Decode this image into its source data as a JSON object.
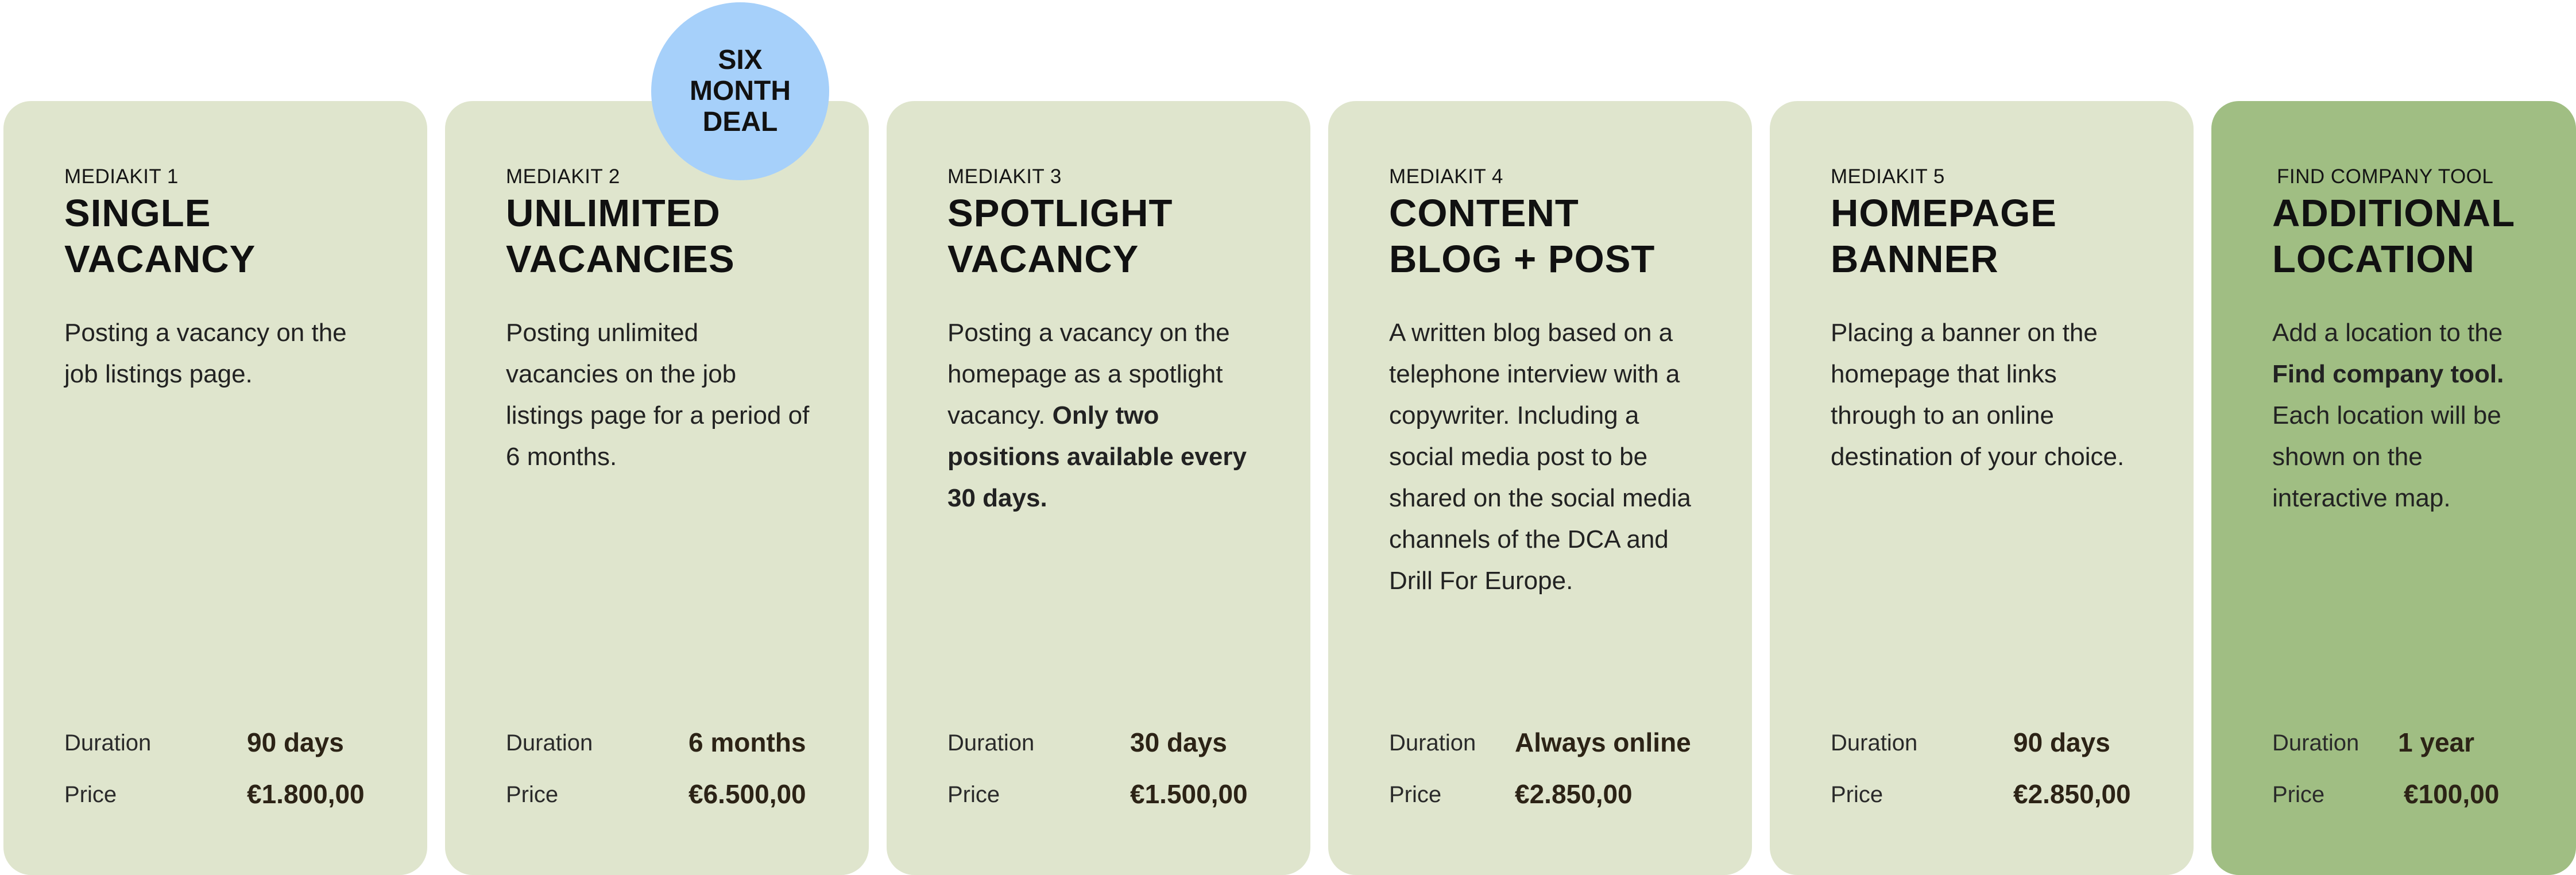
{
  "labels": {
    "duration": "Duration",
    "price": "Price"
  },
  "badge": {
    "line1": "SIX",
    "line2": "MONTH",
    "line3": "DEAL"
  },
  "colors": {
    "card": "#dfe5cd",
    "featured_card": "#a0be83",
    "badge": "#a6d0fa"
  },
  "cards": [
    {
      "eyebrow": "MEDIAKIT 1",
      "title1": "SINGLE",
      "title2": "VACANCY",
      "desc": [
        {
          "t": "Posting a vacancy on the job listings page."
        }
      ],
      "duration": "90 days",
      "price": "€1.800,00"
    },
    {
      "eyebrow": "MEDIAKIT 2",
      "title1": "UNLIMITED",
      "title2": "VACANCIES",
      "desc": [
        {
          "t": "Posting unlimited vacancies on the job listings page for a period of 6 months."
        }
      ],
      "duration": "6 months",
      "price": "€6.500,00"
    },
    {
      "eyebrow": "MEDIAKIT 3",
      "title1": "SPOTLIGHT",
      "title2": "VACANCY",
      "desc": [
        {
          "t": "Posting a vacancy on the homepage as a spotlight vacancy. "
        },
        {
          "t": "Only two positions available every 30 days.",
          "b": true
        }
      ],
      "duration": "30 days",
      "price": "€1.500,00"
    },
    {
      "eyebrow": "MEDIAKIT 4",
      "title1": "CONTENT",
      "title2": "BLOG + POST",
      "desc": [
        {
          "t": "A written blog based on a telephone interview with a copywriter. Including a social media post to be shared on the social media channels of the DCA and Drill For Europe."
        }
      ],
      "duration": "Always online",
      "price": "€2.850,00"
    },
    {
      "eyebrow": "MEDIAKIT 5",
      "title1": "HOMEPAGE",
      "title2": "BANNER",
      "desc": [
        {
          "t": "Placing a banner on the homepage that links through to an online destination of your choice."
        }
      ],
      "duration": "90 days",
      "price": "€2.850,00"
    },
    {
      "eyebrow": "FIND COMPANY TOOL",
      "title1": "ADDITIONAL",
      "title2": "LOCATION",
      "desc": [
        {
          "t": "Add a location to the "
        },
        {
          "t": "Find company tool.",
          "b": true
        },
        {
          "t": " Each location will be shown on the interactive map."
        }
      ],
      "duration": "1 year",
      "price": "€100,00"
    }
  ]
}
